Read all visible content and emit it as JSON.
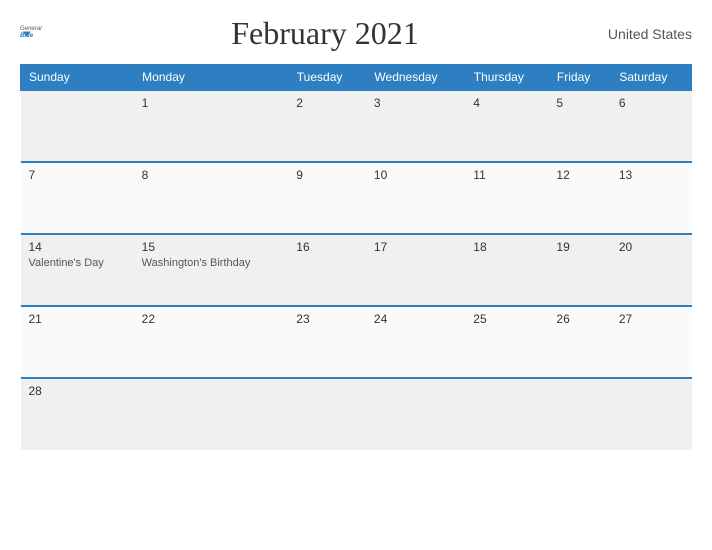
{
  "header": {
    "title": "February 2021",
    "country": "United States",
    "logo_general": "General",
    "logo_blue": "Blue"
  },
  "weekdays": [
    "Sunday",
    "Monday",
    "Tuesday",
    "Wednesday",
    "Thursday",
    "Friday",
    "Saturday"
  ],
  "weeks": [
    [
      {
        "day": "",
        "event": ""
      },
      {
        "day": "1",
        "event": ""
      },
      {
        "day": "2",
        "event": ""
      },
      {
        "day": "3",
        "event": ""
      },
      {
        "day": "4",
        "event": ""
      },
      {
        "day": "5",
        "event": ""
      },
      {
        "day": "6",
        "event": ""
      }
    ],
    [
      {
        "day": "7",
        "event": ""
      },
      {
        "day": "8",
        "event": ""
      },
      {
        "day": "9",
        "event": ""
      },
      {
        "day": "10",
        "event": ""
      },
      {
        "day": "11",
        "event": ""
      },
      {
        "day": "12",
        "event": ""
      },
      {
        "day": "13",
        "event": ""
      }
    ],
    [
      {
        "day": "14",
        "event": "Valentine's Day"
      },
      {
        "day": "15",
        "event": "Washington's Birthday"
      },
      {
        "day": "16",
        "event": ""
      },
      {
        "day": "17",
        "event": ""
      },
      {
        "day": "18",
        "event": ""
      },
      {
        "day": "19",
        "event": ""
      },
      {
        "day": "20",
        "event": ""
      }
    ],
    [
      {
        "day": "21",
        "event": ""
      },
      {
        "day": "22",
        "event": ""
      },
      {
        "day": "23",
        "event": ""
      },
      {
        "day": "24",
        "event": ""
      },
      {
        "day": "25",
        "event": ""
      },
      {
        "day": "26",
        "event": ""
      },
      {
        "day": "27",
        "event": ""
      }
    ],
    [
      {
        "day": "28",
        "event": ""
      },
      {
        "day": "",
        "event": ""
      },
      {
        "day": "",
        "event": ""
      },
      {
        "day": "",
        "event": ""
      },
      {
        "day": "",
        "event": ""
      },
      {
        "day": "",
        "event": ""
      },
      {
        "day": "",
        "event": ""
      }
    ]
  ]
}
